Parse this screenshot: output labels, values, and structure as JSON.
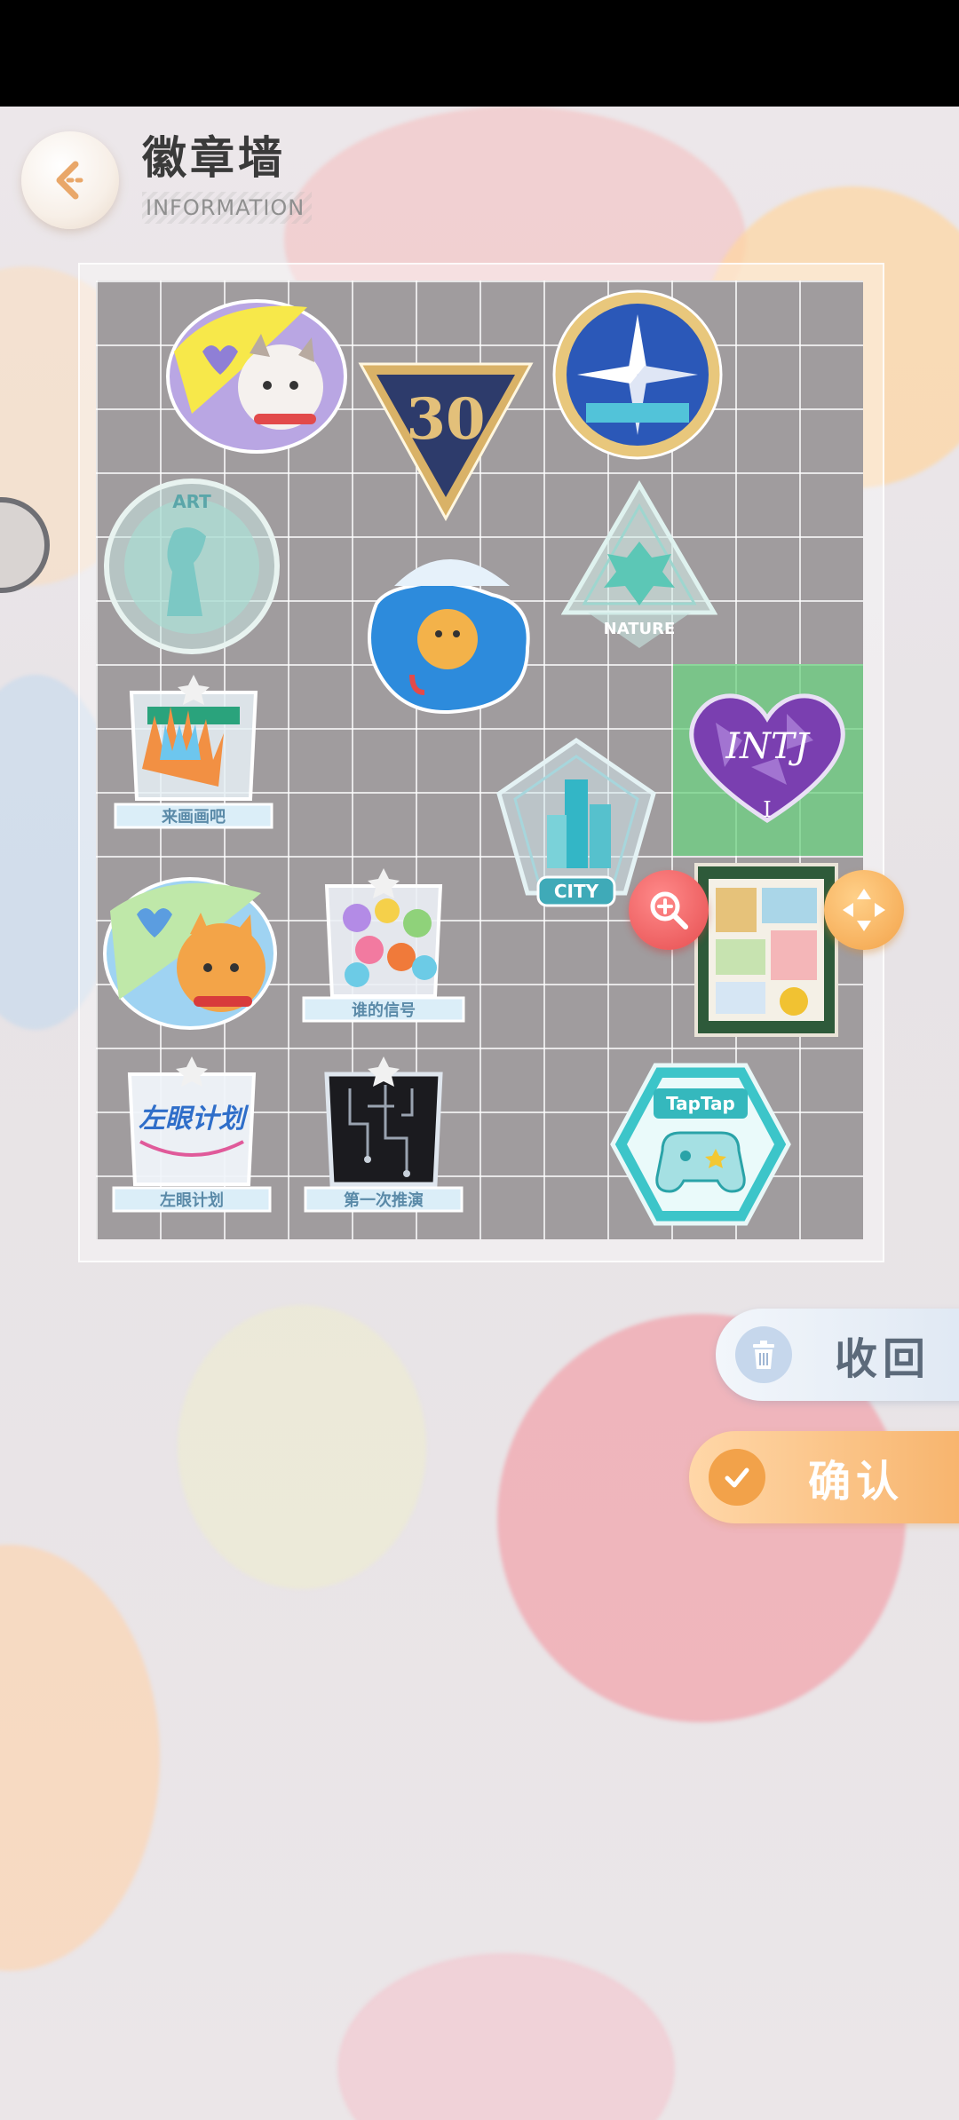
{
  "header": {
    "title": "徽章墙",
    "subtitle": "INFORMATION"
  },
  "badges": {
    "anniversary_number": "30",
    "art_label": "ART",
    "nature_label": "NATURE",
    "intj_label": "INTJ",
    "intj_sub": "I",
    "city_label": "CITY",
    "paint_label": "来画画吧",
    "whose_signal_label": "谁的信号",
    "left_eye_label": "左眼计划",
    "left_eye_art": "左眼计划",
    "first_trial_label": "第一次推演",
    "taptap_label": "TapTap"
  },
  "actions": {
    "recall_label": "收回",
    "confirm_label": "确认"
  },
  "colors": {
    "accent_orange": "#f3a34a",
    "zoom_red": "#e64e50",
    "selection_green": "#6ed282"
  }
}
